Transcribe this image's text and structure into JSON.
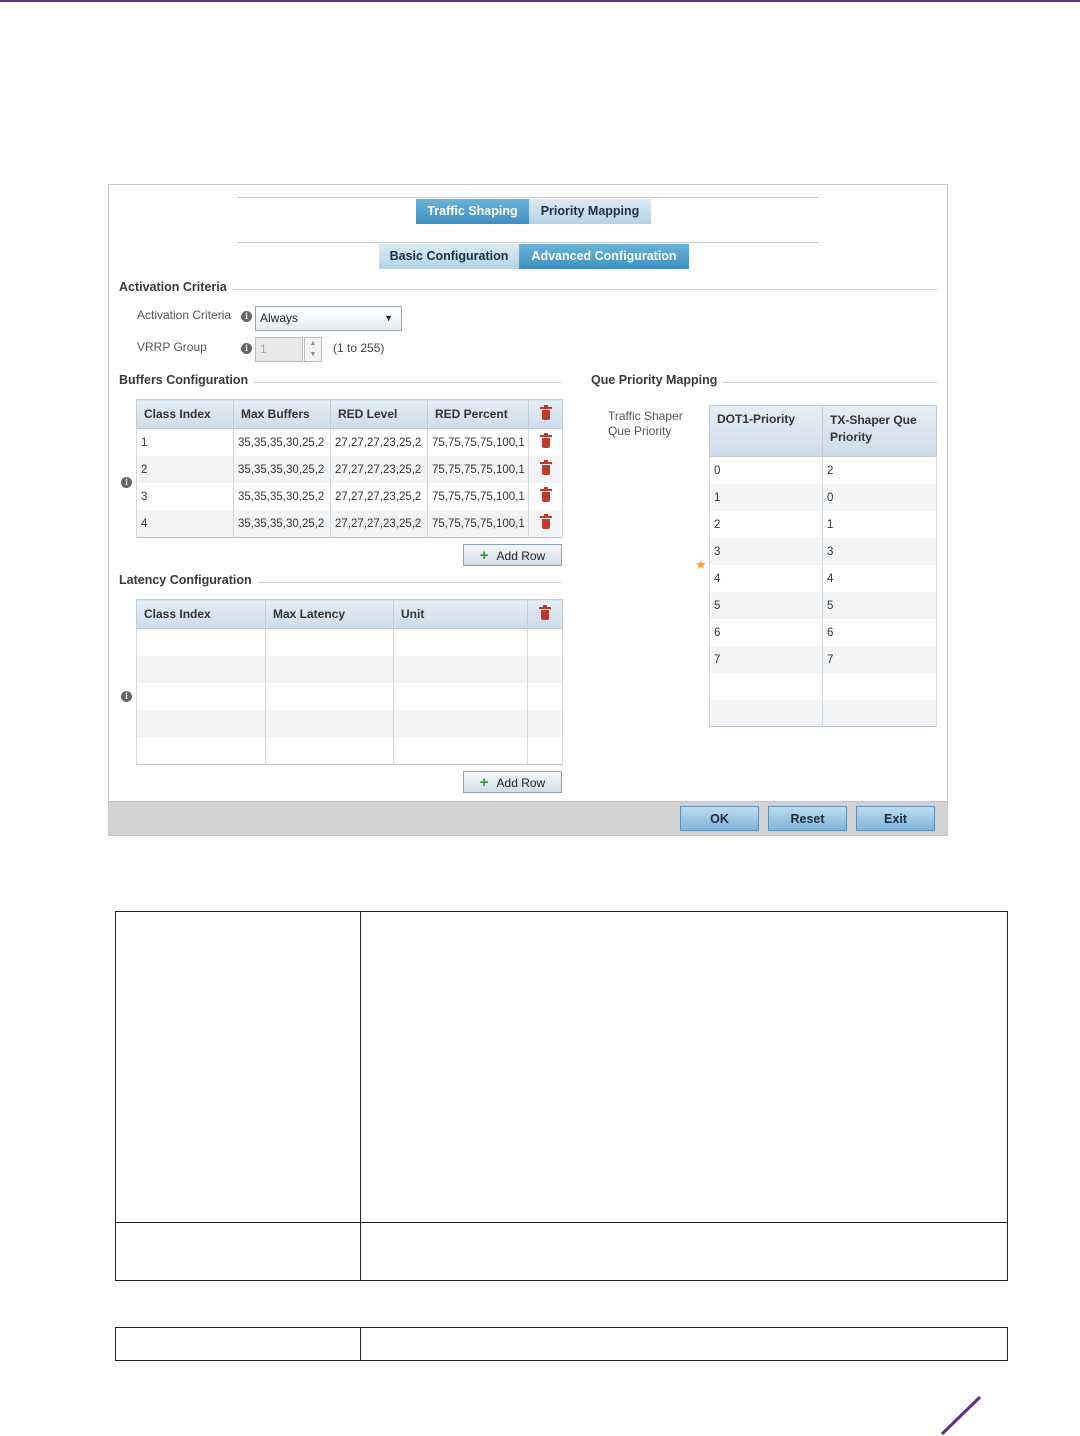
{
  "tabs": {
    "primary": [
      "Traffic Shaping",
      "Priority Mapping"
    ],
    "secondary": [
      "Basic Configuration",
      "Advanced Configuration"
    ]
  },
  "activation": {
    "title": "Activation Criteria",
    "criteria_label": "Activation Criteria",
    "criteria_value": "Always",
    "vrrp_label": "VRRP Group",
    "vrrp_value": "1",
    "vrrp_range": "(1 to 255)"
  },
  "buffers": {
    "title": "Buffers Configuration",
    "columns": [
      "Class Index",
      "Max Buffers",
      "RED Level",
      "RED Percent"
    ],
    "rows": [
      [
        "1",
        "35,35,35,30,25,2",
        "27,27,27,23,25,2",
        "75,75,75,75,100,1"
      ],
      [
        "2",
        "35,35,35,30,25,2",
        "27,27,27,23,25,2",
        "75,75,75,75,100,1"
      ],
      [
        "3",
        "35,35,35,30,25,2",
        "27,27,27,23,25,2",
        "75,75,75,75,100,1"
      ],
      [
        "4",
        "35,35,35,30,25,2",
        "27,27,27,23,25,2",
        "75,75,75,75,100,1"
      ]
    ],
    "add_row": "Add Row"
  },
  "latency": {
    "title": "Latency Configuration",
    "columns": [
      "Class Index",
      "Max Latency",
      "Unit"
    ],
    "add_row": "Add Row"
  },
  "que_priority": {
    "title": "Que Priority Mapping",
    "label": "Traffic Shaper Que Priority",
    "columns": [
      "DOT1-Priority",
      "TX-Shaper Que Priority"
    ],
    "rows": [
      [
        "0",
        "2"
      ],
      [
        "1",
        "0"
      ],
      [
        "2",
        "1"
      ],
      [
        "3",
        "3"
      ],
      [
        "4",
        "4"
      ],
      [
        "5",
        "5"
      ],
      [
        "6",
        "6"
      ],
      [
        "7",
        "7"
      ]
    ]
  },
  "footer": {
    "ok": "OK",
    "reset": "Reset",
    "exit": "Exit"
  },
  "colors": {
    "accent": "#5b2d8e",
    "tab_active": "#3e8fc0",
    "trash": "#c0392b"
  }
}
